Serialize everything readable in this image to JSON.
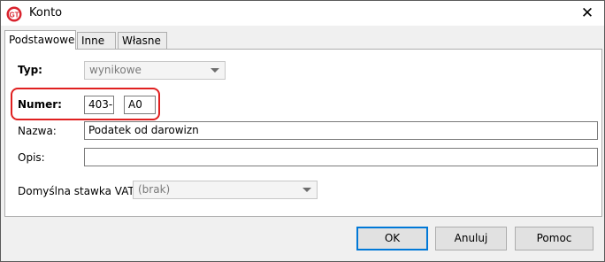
{
  "window": {
    "title": "Konto",
    "close_label": "✕"
  },
  "tabs": [
    {
      "label": "Podstawowe",
      "active": true
    },
    {
      "label": "Inne",
      "active": false
    },
    {
      "label": "Własne",
      "active": false
    }
  ],
  "form": {
    "typ_label": "Typ:",
    "typ_value": "wynikowe",
    "numer_label": "Numer:",
    "numer_value1": "403-",
    "numer_value2": "A0",
    "nazwa_label": "Nazwa:",
    "nazwa_value": "Podatek od darowizn",
    "opis_label": "Opis:",
    "opis_value": "",
    "vat_label": "Domyślna stawka VAT:",
    "vat_value": "(brak)"
  },
  "buttons": {
    "ok": "OK",
    "cancel": "Anuluj",
    "help": "Pomoc"
  },
  "colors": {
    "highlight": "#e02020",
    "accent": "#0078d7"
  }
}
